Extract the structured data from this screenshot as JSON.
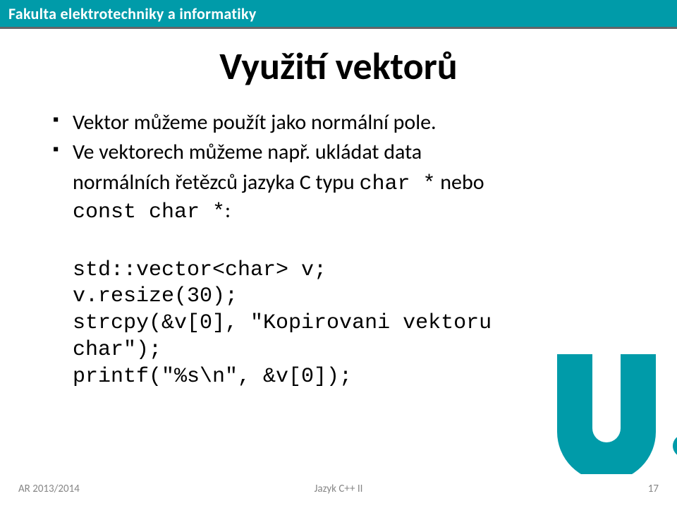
{
  "header": {
    "faculty": "Fakulta elektrotechniky a informatiky"
  },
  "slide": {
    "title": "Využití vektorů",
    "bullets": [
      "Vektor můžeme použít jako normální pole.",
      "Ve vektorech můžeme např. ukládat data"
    ],
    "bullet2_line2_plain_a": "normálních řetězců jazyka C typu ",
    "bullet2_line2_mono_a": "char *",
    "bullet2_line2_plain_b": "  nebo",
    "bullet2_line3_mono": "const char *",
    "bullet2_line3_plain": ":",
    "code": "std::vector<char> v;\nv.resize(30);\nstrcpy(&v[0], \"Kopirovani vektoru\nchar\");\nprintf(\"%s\\n\", &v[0]);"
  },
  "footer": {
    "left": "AR 2013/2014",
    "center": "Jazyk C++ II",
    "right": "17"
  },
  "colors": {
    "accent": "#009ba9",
    "underline": "#636569",
    "footerText": "#868686"
  }
}
